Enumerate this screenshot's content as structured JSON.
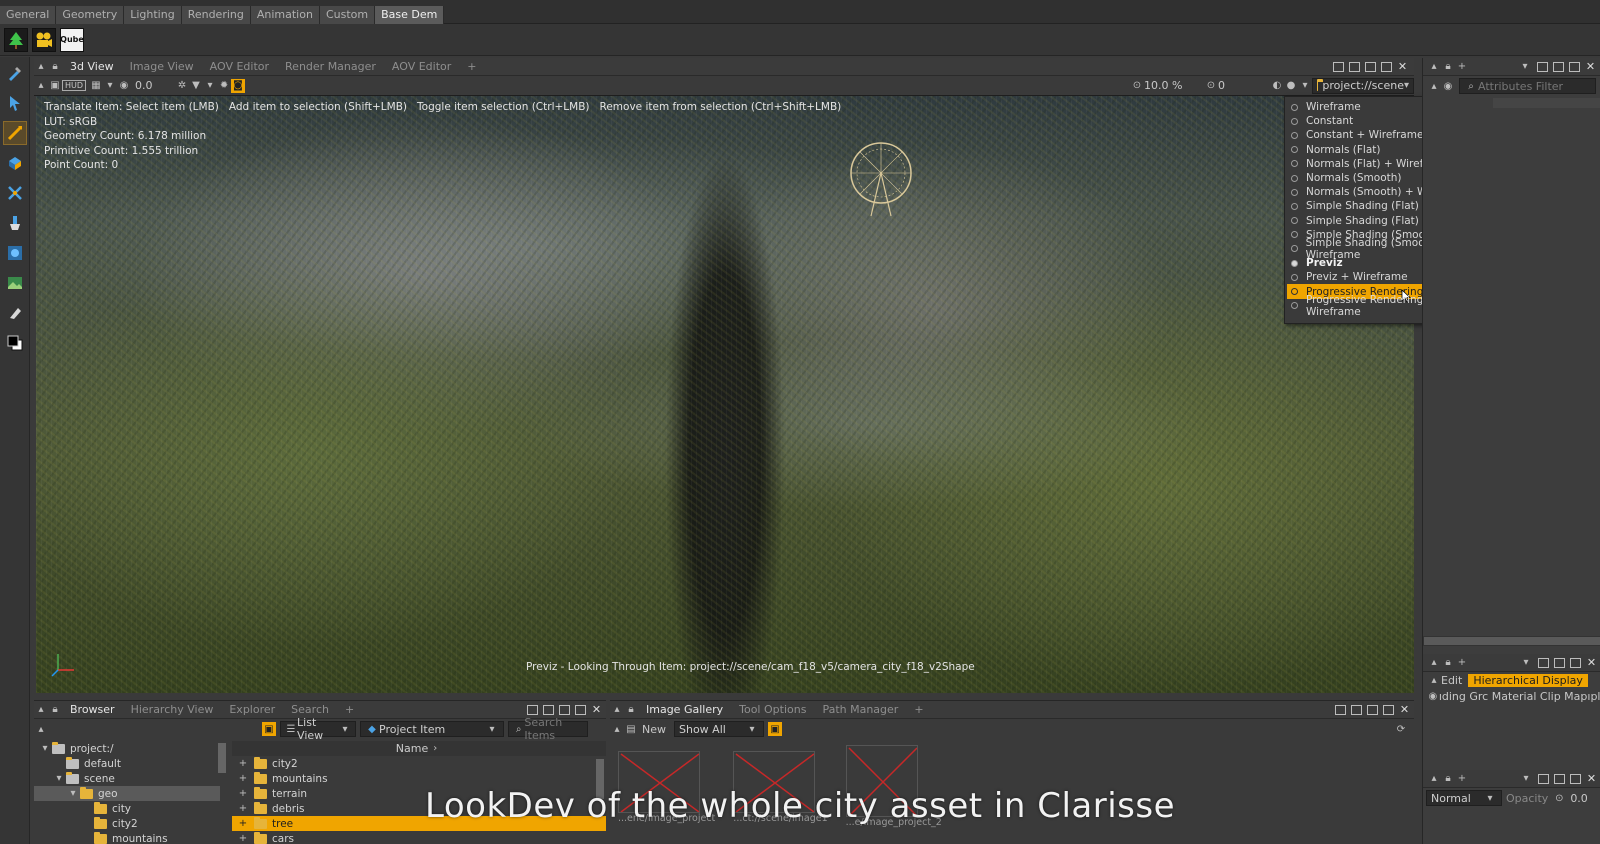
{
  "top_tabs": [
    {
      "label": "General"
    },
    {
      "label": "Geometry"
    },
    {
      "label": "Lighting"
    },
    {
      "label": "Rendering"
    },
    {
      "label": "Animation"
    },
    {
      "label": "Custom"
    },
    {
      "label": "Base Dem"
    }
  ],
  "shelf": {
    "qube_label": "Qube"
  },
  "view_panel": {
    "tabs": [
      "3d View",
      "Image View",
      "AOV Editor",
      "Render Manager",
      "AOV Editor",
      "+"
    ],
    "hud_label": "HUD",
    "time_value": "0.0",
    "zoom_value": "10.0 %",
    "frame_value": "0",
    "context_path": "project://scene"
  },
  "hud": {
    "instructions": "Translate Item: Select item (LMB)   Add item to selection (Shift+LMB)   Toggle item selection (Ctrl+LMB)   Remove item from selection (Ctrl+Shift+LMB)",
    "lut": "LUT: sRGB",
    "geometry_count": "Geometry Count: 6.178 million",
    "primitive_count": "Primitive Count: 1.555 trillion",
    "point_count": "Point Count: 0",
    "footer": "Previz - Looking Through Item: project://scene/cam_f18_v5/camera_city_f18_v2Shape"
  },
  "shading_menu": {
    "items": [
      {
        "label": "Wireframe"
      },
      {
        "label": "Constant"
      },
      {
        "label": "Constant + Wireframe"
      },
      {
        "label": "Normals (Flat)"
      },
      {
        "label": "Normals (Flat) + Wireframe"
      },
      {
        "label": "Normals (Smooth)"
      },
      {
        "label": "Normals (Smooth) + Wireframe"
      },
      {
        "label": "Simple Shading (Flat)"
      },
      {
        "label": "Simple Shading (Flat) + Wireframe"
      },
      {
        "label": "Simple Shading (Smooth)"
      },
      {
        "label": "Simple Shading (Smooth) + Wireframe"
      },
      {
        "label": "Previz"
      },
      {
        "label": "Previz + Wireframe"
      },
      {
        "label": "Progressive Rendering"
      },
      {
        "label": "Progressive Rendering + Wireframe"
      }
    ],
    "selected_index": 11,
    "highlight_index": 13
  },
  "right_panel": {
    "filter_placeholder": "Attributes Filter",
    "edit_label": "Edit",
    "hier_label": "Hierarchical Display",
    "layer_text": "ıding Grc Material Clip Mapıplacem",
    "blend_mode": "Normal",
    "opacity_label": "Opacity",
    "opacity_value": "0.0"
  },
  "browser": {
    "tabs": [
      "Browser",
      "Hierarchy View",
      "Explorer",
      "Search",
      "+"
    ],
    "view_mode": "List View",
    "item_type": "Project Item",
    "search_placeholder": "Search Items",
    "column_name": "Name",
    "tree": [
      {
        "label": "project:/"
      },
      {
        "label": "default"
      },
      {
        "label": "scene"
      },
      {
        "label": "geo"
      },
      {
        "label": "city"
      },
      {
        "label": "city2"
      },
      {
        "label": "mountains"
      }
    ],
    "list": [
      {
        "label": "city2"
      },
      {
        "label": "mountains"
      },
      {
        "label": "terrain"
      },
      {
        "label": "debris"
      },
      {
        "label": "tree"
      },
      {
        "label": "cars"
      }
    ]
  },
  "gallery": {
    "tabs": [
      "Image Gallery",
      "Tool Options",
      "Path Manager",
      "+"
    ],
    "new_label": "New",
    "filter": "Show All",
    "thumbs": [
      {
        "label": "...ene/image_project"
      },
      {
        "label": "...ct://scene/image1"
      },
      {
        "label": "...e/image_project_2"
      }
    ]
  },
  "subtitle": "LookDev of the whole city asset in Clarisse",
  "colors": {
    "accent": "#f0a500",
    "panel": "#3a3a3a"
  }
}
